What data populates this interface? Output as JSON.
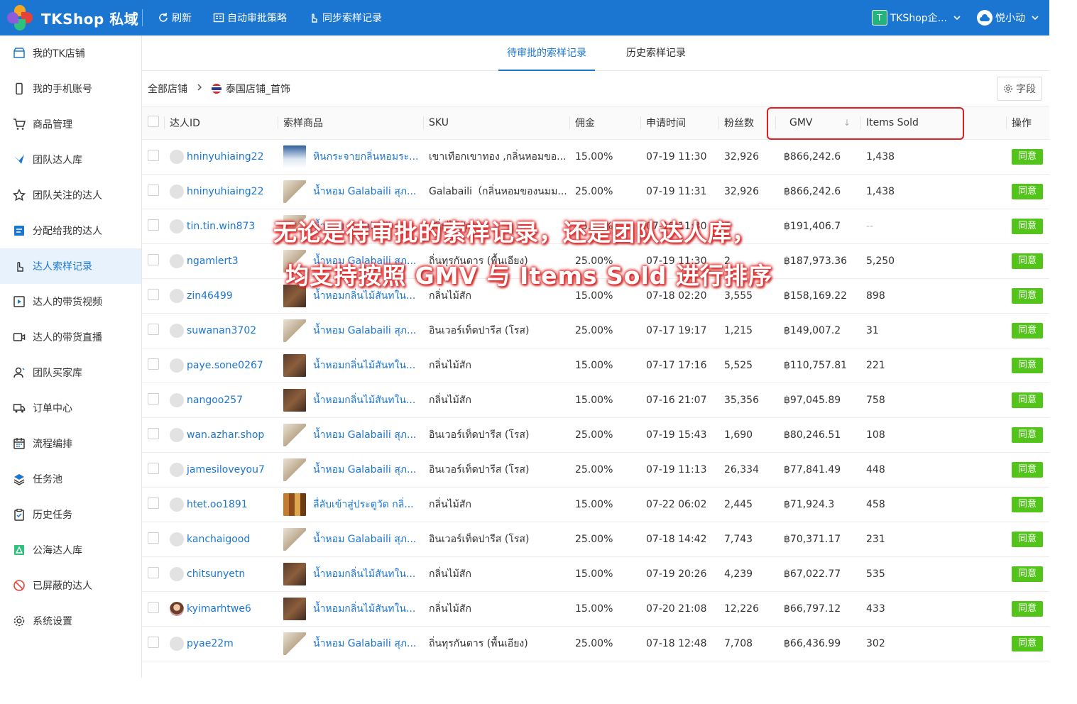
{
  "app": {
    "title": "TKShop 私域",
    "toolbar": {
      "refresh": "刷新",
      "auto_policy": "自动审批策略",
      "sync": "同步索样记录"
    },
    "org": {
      "badge": "T",
      "name": "TKShop企..."
    },
    "user": {
      "name": "悦小动"
    }
  },
  "sidebar": {
    "items": [
      {
        "label": "我的TK店铺",
        "icon": "store-icon"
      },
      {
        "label": "我的手机账号",
        "icon": "phone-icon"
      },
      {
        "label": "商品管理",
        "icon": "cart-icon"
      },
      {
        "label": "团队达人库",
        "icon": "bird-icon"
      },
      {
        "label": "团队关注的达人",
        "icon": "star-icon"
      },
      {
        "label": "分配给我的达人",
        "icon": "assign-icon"
      },
      {
        "label": "达人索样记录",
        "icon": "hand-pointer-icon"
      },
      {
        "label": "达人的带货视频",
        "icon": "video-icon"
      },
      {
        "label": "达人的带货直播",
        "icon": "live-icon"
      },
      {
        "label": "团队买家库",
        "icon": "buyer-icon"
      },
      {
        "label": "订单中心",
        "icon": "truck-icon"
      },
      {
        "label": "流程编排",
        "icon": "calendar-icon"
      },
      {
        "label": "任务池",
        "icon": "layers-icon"
      },
      {
        "label": "历史任务",
        "icon": "clipboard-icon"
      },
      {
        "label": "公海达人库",
        "icon": "public-pool-icon"
      },
      {
        "label": "已屏蔽的达人",
        "icon": "block-icon"
      },
      {
        "label": "系统设置",
        "icon": "gear-icon"
      }
    ],
    "active_index": 6
  },
  "tabs": {
    "pending": "待审批的索样记录",
    "history": "历史索样记录"
  },
  "breadcrumb": {
    "all": "全部店铺",
    "shop": "泰国店铺_首饰"
  },
  "field_button": "字段",
  "table": {
    "headers": {
      "creator": "达人ID",
      "product": "索样商品",
      "sku": "SKU",
      "commission": "佣金",
      "applied": "申请时间",
      "fans": "粉丝数",
      "gmv": "GMV",
      "items_sold": "Items Sold",
      "action": "操作"
    },
    "agree_label": "同意",
    "rows": [
      {
        "creator": "hninyuhiaing22",
        "product": "หินกระจายกลิ่นหอมระ...",
        "thumb": "sky",
        "sku": "เขาเทือกเขาทอง ,กลิ่นหอมขอ...",
        "commission": "15.00%",
        "applied": "07-19 11:30",
        "fans": "32,926",
        "gmv": "฿866,242.6",
        "items_sold": "1,438"
      },
      {
        "creator": "hninyuhiaing22",
        "product": "น้ำหอม Galabaili สุภ...",
        "thumb": "bottle",
        "sku": "Galabaili（กลิ่นหอมของนมม...",
        "commission": "25.00%",
        "applied": "07-19 11:31",
        "fans": "32,926",
        "gmv": "฿866,242.6",
        "items_sold": "1,438"
      },
      {
        "creator": "tin.tin.win873",
        "product": "น้ำหอม Galabaili สุภ...",
        "thumb": "bottle",
        "sku": "กลิ่นไม้สัก",
        "commission": "15.00%",
        "applied": "07-19 11:30",
        "fans": "7",
        "gmv": "฿191,406.7",
        "items_sold": "--"
      },
      {
        "creator": "ngamlert3",
        "product": "น้ำหอม Galabaili สุภ...",
        "thumb": "bottle",
        "sku": "ถิ่นทุรกันดาร (พื้นเอียง)",
        "commission": "25.00%",
        "applied": "07-19 11:30",
        "fans": "2",
        "gmv": "฿187,973.36",
        "items_sold": "5,250"
      },
      {
        "creator": "zin46499",
        "product": "น้ำหอมกลิ่นไม้สันทใน...",
        "thumb": "brown",
        "sku": "กลิ่นไม้สัก",
        "commission": "15.00%",
        "applied": "07-18 02:20",
        "fans": "3,555",
        "gmv": "฿158,169.22",
        "items_sold": "898"
      },
      {
        "creator": "suwanan3702",
        "product": "น้ำหอม Galabaili สุภ...",
        "thumb": "bottle",
        "sku": "อินเวอร์เท็ดปารีส (โรส)",
        "commission": "25.00%",
        "applied": "07-17 19:17",
        "fans": "1,215",
        "gmv": "฿149,007.2",
        "items_sold": "31"
      },
      {
        "creator": "paye.sone0267",
        "product": "น้ำหอมกลิ่นไม้สันทใน...",
        "thumb": "brown",
        "sku": "กลิ่นไม้สัก",
        "commission": "15.00%",
        "applied": "07-17 17:16",
        "fans": "5,525",
        "gmv": "฿110,757.81",
        "items_sold": "221"
      },
      {
        "creator": "nangoo257",
        "product": "น้ำหอมกลิ่นไม้สันทใน...",
        "thumb": "brown",
        "sku": "กลิ่นไม้สัก",
        "commission": "15.00%",
        "applied": "07-16 21:07",
        "fans": "35,356",
        "gmv": "฿97,045.89",
        "items_sold": "758"
      },
      {
        "creator": "wan.azhar.shop",
        "product": "น้ำหอม Galabaili สุภ...",
        "thumb": "bottle",
        "sku": "อินเวอร์เท็ดปารีส (โรส)",
        "commission": "25.00%",
        "applied": "07-19 15:43",
        "fans": "1,690",
        "gmv": "฿80,246.51",
        "items_sold": "108"
      },
      {
        "creator": "jamesiloveyou7",
        "product": "น้ำหอม Galabaili สุภ...",
        "thumb": "bottle",
        "sku": "อินเวอร์เท็ดปารีส (โรส)",
        "commission": "25.00%",
        "applied": "07-19 11:13",
        "fans": "26,334",
        "gmv": "฿77,841.49",
        "items_sold": "448"
      },
      {
        "creator": "htet.oo1891",
        "product": "ลื่ลับเข้าสู่ประตูวัด กลิ่...",
        "thumb": "multi",
        "sku": "กลิ่นไม้สัก",
        "commission": "15.00%",
        "applied": "07-22 06:02",
        "fans": "2,445",
        "gmv": "฿71,924.3",
        "items_sold": "458"
      },
      {
        "creator": "kanchaigood",
        "product": "น้ำหอม Galabaili สุภ...",
        "thumb": "bottle",
        "sku": "อินเวอร์เท็ดปารีส (โรส)",
        "commission": "25.00%",
        "applied": "07-18 14:42",
        "fans": "7,743",
        "gmv": "฿70,371.17",
        "items_sold": "231"
      },
      {
        "creator": "chitsunyetn",
        "product": "น้ำหอมกลิ่นไม้สันทใน...",
        "thumb": "brown",
        "sku": "กลิ่นไม้สัก",
        "commission": "15.00%",
        "applied": "07-19 20:26",
        "fans": "4,239",
        "gmv": "฿67,022.77",
        "items_sold": "535"
      },
      {
        "creator": "kyimarhtwe6",
        "product": "น้ำหอมกลิ่นไม้สันทใน...",
        "thumb": "brown",
        "sku": "กลิ่นไม้สัก",
        "commission": "15.00%",
        "applied": "07-20 21:08",
        "fans": "12,226",
        "gmv": "฿66,797.12",
        "items_sold": "433",
        "avatar": "photo"
      },
      {
        "creator": "pyae22m",
        "product": "น้ำหอม Galabaili สุภ...",
        "thumb": "bottle",
        "sku": "ถิ่นทุรกันดาร (พื้นเอียง)",
        "commission": "25.00%",
        "applied": "07-18 12:48",
        "fans": "7,708",
        "gmv": "฿66,436.99",
        "items_sold": "302"
      }
    ]
  },
  "caption": {
    "line1": "无论是待审批的索样记录，还是团队达人库，",
    "line2": "均支持按照 GMV 与 Items Sold 进行排序"
  },
  "colors": {
    "brand": "#1b76d2",
    "agree": "#52c41a",
    "highlight": "#e02020"
  }
}
